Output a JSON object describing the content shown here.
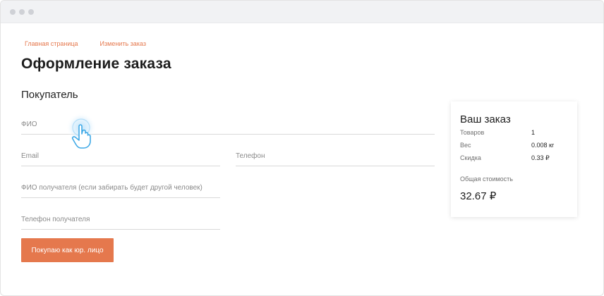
{
  "breadcrumb": {
    "home": "Главная страница",
    "edit_order": "Изменить заказ"
  },
  "page": {
    "title": "Оформление заказа",
    "buyer_section": "Покупатель"
  },
  "form": {
    "fio_placeholder": "ФИО",
    "email_placeholder": "Email",
    "phone_placeholder": "Телефон",
    "recipient_name_placeholder": "ФИО получателя (если забирать будет другой человек)",
    "recipient_phone_placeholder": "Телефон получателя",
    "legal_entity_button": "Покупаю как юр. лицо"
  },
  "order_summary": {
    "title": "Ваш заказ",
    "rows": [
      {
        "label": "Товаров",
        "value": "1"
      },
      {
        "label": "Вес",
        "value": "0.008 кг"
      },
      {
        "label": "Скидка",
        "value": "0.33 ₽"
      }
    ],
    "total_label": "Общая стоимость",
    "total_value": "32.67 ₽"
  },
  "colors": {
    "accent": "#e5784d",
    "cursor_blue": "#3fa9e6"
  },
  "icons": {
    "cursor": "hand-pointer-icon"
  }
}
